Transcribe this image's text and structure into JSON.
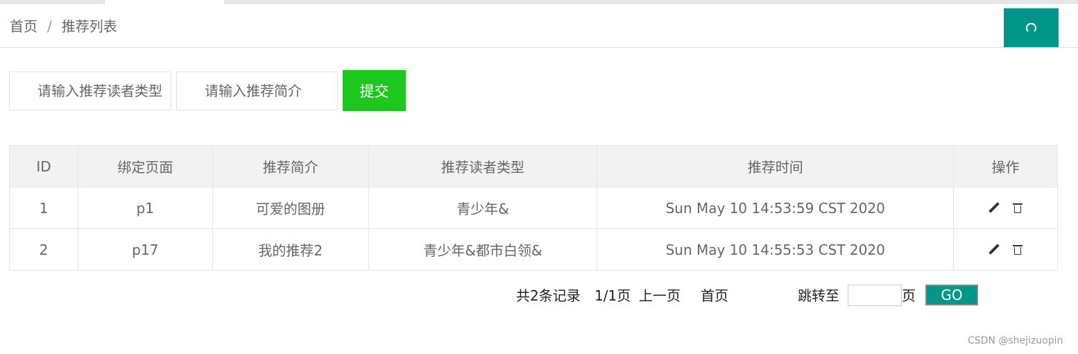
{
  "breadcrumb": {
    "home": "首页",
    "separator": "/",
    "current": "推荐列表"
  },
  "header": {
    "refresh_icon": "refresh-icon"
  },
  "search": {
    "reader_type_placeholder": "请输入推荐读者类型",
    "intro_placeholder": "请输入推荐简介",
    "submit_label": "提交"
  },
  "table": {
    "headers": [
      "ID",
      "绑定页面",
      "推荐简介",
      "推荐读者类型",
      "推荐时间",
      "操作"
    ],
    "rows": [
      {
        "id": "1",
        "page": "p1",
        "intro": "可爱的图册",
        "reader_type": "青少年&",
        "time": "Sun May 10 14:53:59 CST 2020"
      },
      {
        "id": "2",
        "page": "p17",
        "intro": "我的推荐2",
        "reader_type": "青少年&都市白领&",
        "time": "Sun May 10 14:55:53 CST 2020"
      }
    ]
  },
  "pager": {
    "summary": "共2条记录",
    "page_info": "1/1页",
    "prev": "上一页",
    "first": "首页",
    "jump_label": "跳转至",
    "page_unit": "页",
    "go_label": "GO"
  },
  "watermark": "CSDN @shejizuopin",
  "colors": {
    "teal": "#009688",
    "green": "#1ec71e"
  }
}
